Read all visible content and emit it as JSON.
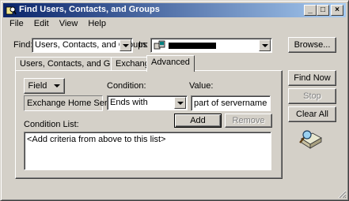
{
  "window": {
    "title": "Find Users, Contacts, and Groups",
    "controls": {
      "minimize": "_",
      "maximize": "□",
      "close": "×"
    }
  },
  "menu": {
    "items": [
      {
        "label": "File"
      },
      {
        "label": "Edit"
      },
      {
        "label": "View"
      },
      {
        "label": "Help"
      }
    ]
  },
  "find_row": {
    "find_label": "Find:",
    "find_value": "Users, Contacts, and Groups",
    "in_label": "In:",
    "in_value": "",
    "browse_label": "Browse..."
  },
  "tabs": [
    {
      "label": "Users, Contacts, and Groups",
      "active": false
    },
    {
      "label": "Exchange",
      "active": false
    },
    {
      "label": "Advanced",
      "active": true
    }
  ],
  "advanced": {
    "field_button": "Field",
    "condition_label": "Condition:",
    "value_label": "Value:",
    "selected_field": "Exchange Home Server",
    "condition_value": "Ends with",
    "value_input": "part of servername",
    "add_label": "Add",
    "remove_label": "Remove",
    "condition_list_label": "Condition List:",
    "condition_list_placeholder": "<Add criteria from above to this list>"
  },
  "side_buttons": {
    "find_now": "Find Now",
    "stop": "Stop",
    "clear_all": "Clear All"
  },
  "colors": {
    "face": "#d4d0c8",
    "title_start": "#0a246a",
    "title_end": "#a6caf0",
    "desktop": "#3a6ea5"
  }
}
